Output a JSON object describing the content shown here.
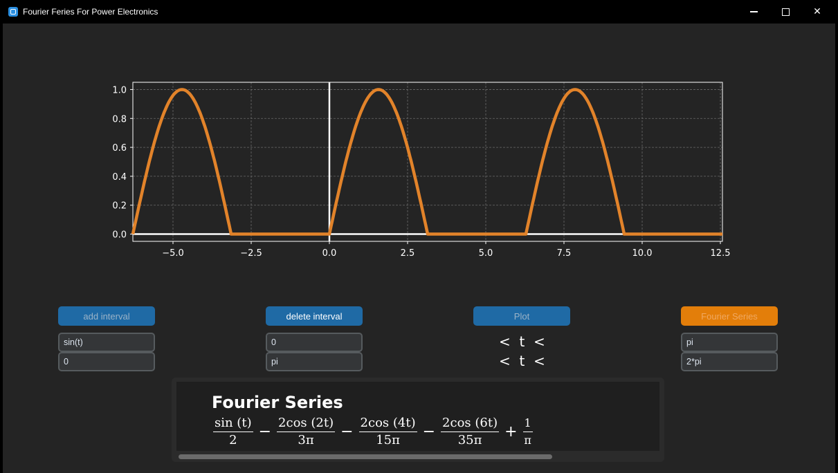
{
  "window": {
    "title": "Fourier Feries For Power Electronics"
  },
  "colors": {
    "curve": "#e2832a",
    "axis": "#ffffff",
    "grid": "#6a6a6a",
    "button_blue": "#1f6aa5",
    "button_orange": "#e37e0a"
  },
  "chart_data": {
    "type": "line",
    "title": "",
    "xlabel": "",
    "ylabel": "",
    "xlim": [
      -6.283,
      12.566
    ],
    "ylim": [
      -0.05,
      1.05
    ],
    "xticks": [
      -5.0,
      -2.5,
      0.0,
      2.5,
      5.0,
      7.5,
      10.0,
      12.5
    ],
    "xtick_labels": [
      "−5.0",
      "−2.5",
      "0.0",
      "2.5",
      "5.0",
      "7.5",
      "10.0",
      "12.5"
    ],
    "yticks": [
      0.0,
      0.2,
      0.4,
      0.6,
      0.8,
      1.0
    ],
    "ytick_labels": [
      "0.0",
      "0.2",
      "0.4",
      "0.6",
      "0.8",
      "1.0"
    ],
    "grid": true,
    "series": [
      {
        "function": "half-wave rectified sin(t)",
        "x": [
          -6.283,
          -5.498,
          -4.712,
          -3.927,
          -3.142,
          0.0,
          0.785,
          1.571,
          2.356,
          3.142,
          6.283,
          7.069,
          7.854,
          8.639,
          9.425,
          12.566
        ],
        "y": [
          0.0,
          0.707,
          1.0,
          0.707,
          0.0,
          0.0,
          0.707,
          1.0,
          0.707,
          0.0,
          0.0,
          0.707,
          1.0,
          0.707,
          0.0,
          0.0
        ]
      }
    ]
  },
  "buttons": {
    "add_interval": "add interval",
    "delete_interval": "delete interval",
    "plot": "Plot",
    "fourier_series": "Fourier Series"
  },
  "inputs": {
    "function_1": "sin(t)",
    "function_2": "0",
    "lower_1": "0",
    "lower_2": "pi",
    "upper_1": "pi",
    "upper_2": "2*pi"
  },
  "interval_labels": [
    "<  t  <",
    "<  t  <"
  ],
  "result": {
    "heading": "Fourier Series",
    "terms": {
      "t1_num": "sin (t)",
      "t1_den": "2",
      "op1": "−",
      "t2_num": "2cos (2t)",
      "t2_den": "3π",
      "op2": "−",
      "t3_num": "2cos (4t)",
      "t3_den": "15π",
      "op3": "−",
      "t4_num": "2cos (6t)",
      "t4_den": "35π",
      "op4": "+",
      "t5_num": "1",
      "t5_den": "π"
    }
  }
}
